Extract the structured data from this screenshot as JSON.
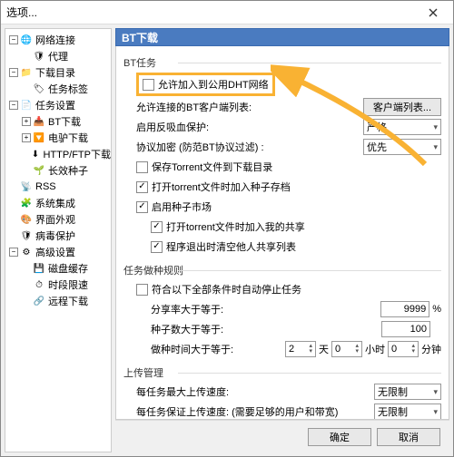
{
  "window": {
    "title": "选项..."
  },
  "sidebar": {
    "items": [
      {
        "label": "网络连接",
        "icon": "🌐",
        "level": 0,
        "expand": "−"
      },
      {
        "label": "代理",
        "icon": "🛡",
        "level": 1
      },
      {
        "label": "下载目录",
        "icon": "📁",
        "level": 0,
        "expand": "−"
      },
      {
        "label": "任务标签",
        "icon": "🏷",
        "level": 1
      },
      {
        "label": "任务设置",
        "icon": "📄",
        "level": 0,
        "expand": "−"
      },
      {
        "label": "BT下载",
        "icon": "📥",
        "level": 1,
        "expand": "+"
      },
      {
        "label": "电驴下载",
        "icon": "🔽",
        "level": 1,
        "expand": "+"
      },
      {
        "label": "HTTP/FTP下载",
        "icon": "⬇",
        "level": 1
      },
      {
        "label": "长效种子",
        "icon": "🌱",
        "level": 1
      },
      {
        "label": "RSS",
        "icon": "📡",
        "level": 0
      },
      {
        "label": "系统集成",
        "icon": "🧩",
        "level": 0
      },
      {
        "label": "界面外观",
        "icon": "🎨",
        "level": 0
      },
      {
        "label": "病毒保护",
        "icon": "🛡",
        "level": 0
      },
      {
        "label": "高级设置",
        "icon": "⚙",
        "level": 0,
        "expand": "−"
      },
      {
        "label": "磁盘缓存",
        "icon": "💾",
        "level": 1
      },
      {
        "label": "时段限速",
        "icon": "⏱",
        "level": 1
      },
      {
        "label": "远程下载",
        "icon": "🔗",
        "level": 1
      }
    ]
  },
  "header": {
    "title": "BT下载"
  },
  "bt_tasks": {
    "group": "BT任务",
    "allow_dht": "允许加入到公用DHT网络",
    "client_list_label": "允许连接的BT客户端列表:",
    "client_list_btn": "客户端列表...",
    "anti_leech_label": "启用反吸血保护:",
    "anti_leech_value": "严格",
    "protocol_encrypt_label": "协议加密 (防范BT协议过滤) :",
    "protocol_encrypt_value": "优先",
    "save_torrent": "保存Torrent文件到下载目录",
    "save_seed_on_open": "打开torrent文件时加入种子存档",
    "enable_market": "启用种子市场",
    "share_on_open": "打开torrent文件时加入我的共享",
    "clear_private_on_exit": "程序退出时清空他人共享列表"
  },
  "stop_rules": {
    "group": "任务做种规则",
    "auto_stop": "符合以下全部条件时自动停止任务",
    "share_ratio_label": "分享率大于等于:",
    "share_ratio_value": "9999",
    "share_ratio_unit": "%",
    "seed_count_label": "种子数大于等于:",
    "seed_count_value": "100",
    "seed_time_label": "做种时间大于等于:",
    "seed_time_day": "2",
    "day_unit": "天",
    "seed_time_hour": "0",
    "hour_unit": "小时",
    "seed_time_min": "0",
    "min_unit": "分钟"
  },
  "upload": {
    "group": "上传管理",
    "max_upload_label": "每任务最大上传速度:",
    "max_upload_value": "无限制",
    "guarantee_label": "每任务保证上传速度: (需要足够的用户和带宽)",
    "guarantee_value": "无限制"
  },
  "footer": {
    "ok": "确定",
    "cancel": "取消"
  }
}
